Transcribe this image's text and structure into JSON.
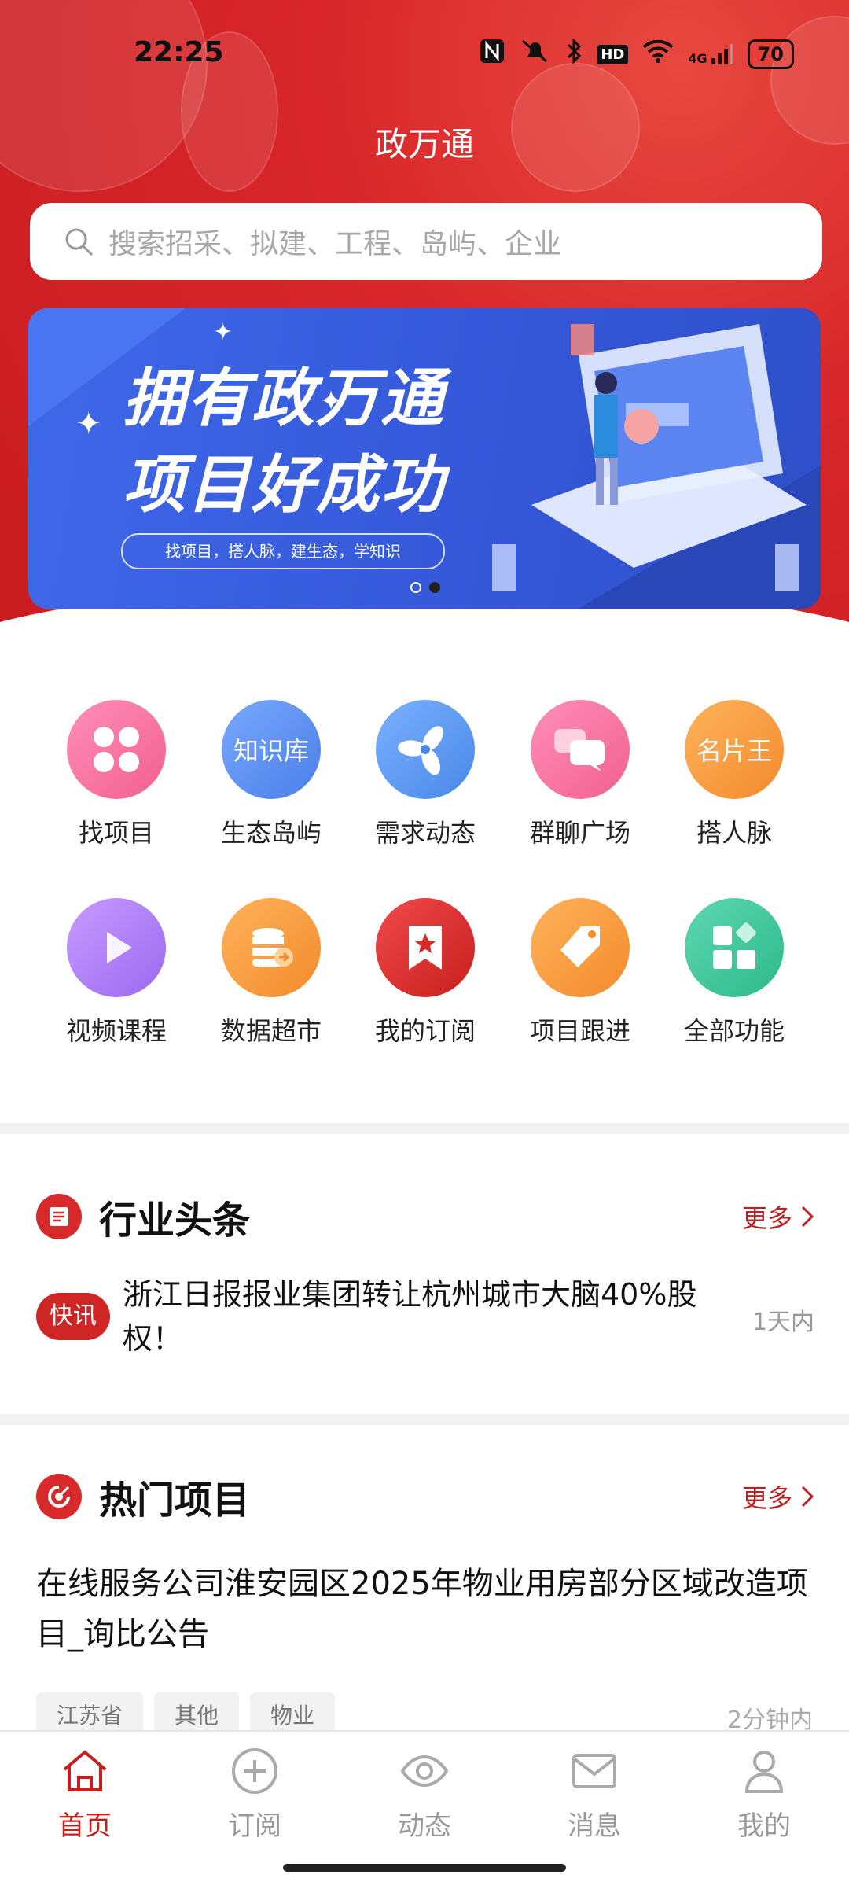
{
  "status_bar": {
    "time": "22:25",
    "battery": "70",
    "network": "4G",
    "hd": "HD"
  },
  "app": {
    "title": "政万通"
  },
  "search": {
    "placeholder": "搜索招采、拟建、工程、岛屿、企业"
  },
  "banner": {
    "line1": "拥有政万通",
    "line2": "项目好成功",
    "subtitle": "找项目，搭人脉，建生态，学知识",
    "page_count": 2,
    "active_page": 2
  },
  "features": [
    {
      "label": "找项目",
      "icon": "clover-icon",
      "icon_text": ""
    },
    {
      "label": "生态岛屿",
      "icon": "knowledge-icon",
      "icon_text": "知识库"
    },
    {
      "label": "需求动态",
      "icon": "fan-icon",
      "icon_text": ""
    },
    {
      "label": "群聊广场",
      "icon": "chat-icon",
      "icon_text": ""
    },
    {
      "label": "搭人脉",
      "icon": "card-icon",
      "icon_text": "名片王"
    },
    {
      "label": "视频课程",
      "icon": "play-icon",
      "icon_text": ""
    },
    {
      "label": "数据超市",
      "icon": "database-icon",
      "icon_text": ""
    },
    {
      "label": "我的订阅",
      "icon": "bookmark-star-icon",
      "icon_text": ""
    },
    {
      "label": "项目跟进",
      "icon": "tag-icon",
      "icon_text": ""
    },
    {
      "label": "全部功能",
      "icon": "grid-icon",
      "icon_text": ""
    }
  ],
  "industry_news": {
    "title": "行业头条",
    "more": "更多",
    "item": {
      "badge": "快讯",
      "text": "浙江日报报业集团转让杭州城市大脑40%股权！",
      "time": "1天内"
    }
  },
  "hot_projects": {
    "title": "热门项目",
    "more": "更多",
    "item": {
      "title": "在线服务公司淮安园区2025年物业用房部分区域改造项目_询比公告",
      "tags": [
        "江苏省",
        "其他",
        "物业"
      ],
      "time": "2分钟内"
    }
  },
  "tabbar": [
    {
      "label": "首页",
      "icon": "home-icon",
      "active": true
    },
    {
      "label": "订阅",
      "icon": "plus-circle-icon",
      "active": false
    },
    {
      "label": "动态",
      "icon": "eye-icon",
      "active": false
    },
    {
      "label": "消息",
      "icon": "mail-icon",
      "active": false
    },
    {
      "label": "我的",
      "icon": "user-icon",
      "active": false
    }
  ],
  "colors": {
    "brand_red": "#D8262A",
    "banner_blue": "#3F68E8",
    "tab_active": "#C81E1E"
  }
}
